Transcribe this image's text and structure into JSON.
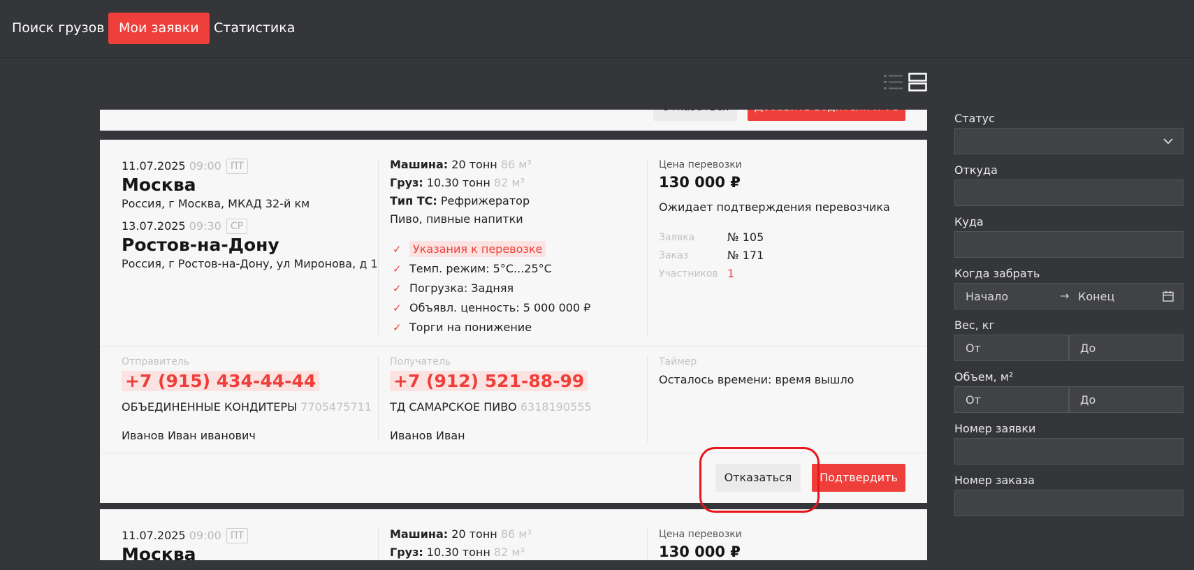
{
  "nav": {
    "items": [
      {
        "label": "Поиск грузов",
        "active": false
      },
      {
        "label": "Мои заявки",
        "active": true
      },
      {
        "label": "Статистика",
        "active": false
      }
    ]
  },
  "view_toggle": {
    "list_icon": "list-view-icon",
    "card_icon": "card-view-icon",
    "selected": "card"
  },
  "partial_card": {
    "decline_label": "Отказаться",
    "add_label": "Добавить водителя и ТС"
  },
  "card": {
    "pickup": {
      "date": "11.07.2025",
      "time": "09:00",
      "day": "ПТ",
      "city": "Москва",
      "address": "Россия, г Москва, МКАД 32-й км"
    },
    "delivery": {
      "date": "13.07.2025",
      "time": "09:30",
      "day": "СР",
      "city": "Ростов-на-Дону",
      "address": "Россия, г Ростов-на-Дону, ул Миронова, д 1"
    },
    "vehicle": {
      "label": "Машина:",
      "tonnage": "20 тонн",
      "volume": "86 м³"
    },
    "cargo": {
      "label": "Груз:",
      "weight": "10.30 тонн",
      "volume": "82 м³"
    },
    "vehicle_type": {
      "label": "Тип ТС:",
      "value": "Рефрижератор"
    },
    "goods": "Пиво, пивные напитки",
    "checks": [
      "Указания к перевозке",
      "Темп. режим: 5°C...25°C",
      "Погрузка: Задняя",
      "Объявл. ценность: 5 000 000 ₽",
      "Торги на понижение"
    ],
    "price_label": "Цена перевозки",
    "price": "130 000 ₽",
    "status": "Ожидает подтверждения перевозчика",
    "request_label": "Заявка",
    "request_value": "№ 105",
    "order_label": "Заказ",
    "order_value": "№ 171",
    "participants_label": "Участников",
    "participants_value": "1",
    "sender": {
      "label": "Отправитель",
      "phone": "+7 (915) 434-44-44",
      "company": "ОБЪЕДИНЕННЫЕ КОНДИТЕРЫ",
      "inn": "7705475711",
      "person": "Иванов Иван иванович"
    },
    "receiver": {
      "label": "Получатель",
      "phone": "+7 (912) 521-88-99",
      "company": "ТД САМАРСКОЕ ПИВО",
      "inn": "6318190555",
      "person": "Иванов Иван"
    },
    "timer": {
      "label": "Таймер",
      "text": "Осталось времени: время вышло"
    },
    "decline_label": "Отказаться",
    "confirm_label": "Подтвердить"
  },
  "next_card": {
    "pickup": {
      "date": "11.07.2025",
      "time": "09:00",
      "day": "ПТ",
      "city": "Москва"
    },
    "vehicle": {
      "label": "Машина:",
      "tonnage": "20 тонн",
      "volume": "86 м³"
    },
    "cargo": {
      "label": "Груз:",
      "weight": "10.30 тонн",
      "volume": "82 м³"
    },
    "price_label": "Цена перевозки",
    "price": "130 000 ₽"
  },
  "filters": {
    "status_label": "Статус",
    "from_label": "Откуда",
    "to_label": "Куда",
    "pickup_label": "Когда забрать",
    "pickup_start": "Начало",
    "pickup_end": "Конец",
    "weight_label": "Вес, кг",
    "weight_from": "От",
    "weight_to": "До",
    "volume_label": "Объем, м²",
    "volume_from": "От",
    "volume_to": "До",
    "request_num_label": "Номер заявки",
    "order_num_label": "Номер заказа"
  },
  "colors": {
    "accent": "#ee3f3a",
    "background": "#35363a",
    "card": "#f7f7f7"
  }
}
